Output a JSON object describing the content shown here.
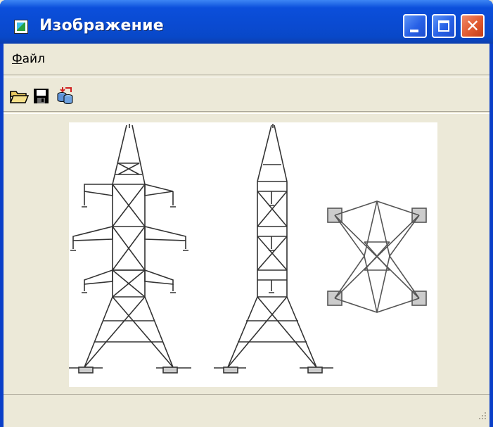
{
  "window": {
    "title": "Изображение"
  },
  "menu": {
    "file_label_first": "Ф",
    "file_label_rest": "айл"
  },
  "toolbar": {
    "buttons": [
      {
        "icon": "open-folder-icon"
      },
      {
        "icon": "save-disk-icon"
      },
      {
        "icon": "database-export-icon"
      }
    ]
  },
  "image": {
    "content": "power-line tower drawings"
  },
  "colors": {
    "title_bar": "#0a4ad0",
    "face": "#ece9d8",
    "close_button": "#e05a30"
  }
}
